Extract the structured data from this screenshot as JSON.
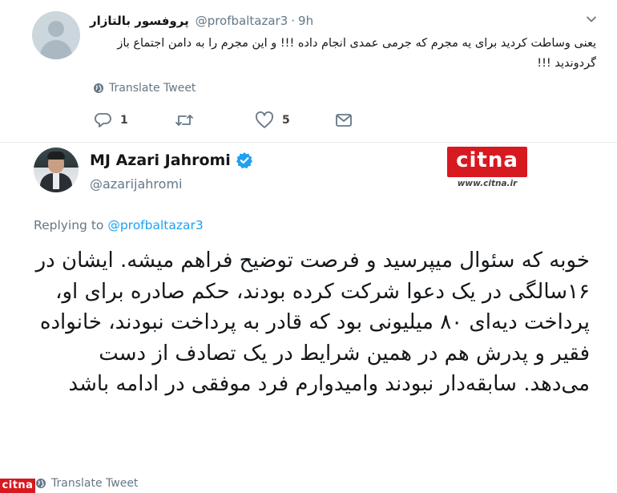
{
  "reply_tweet": {
    "author_name": "پروفسور بالتازار",
    "handle": "@profbaltazar3",
    "separator": "·",
    "time": "9h",
    "text": "یعنی وساطت کردید برای یه مجرم که جرمی عمدی انجام داده !!! و این مجرم را به دامن اجتماع باز گردوندید !!!",
    "translate_label": "Translate Tweet",
    "reply_count": "1",
    "retweet_count": "",
    "like_count": "5"
  },
  "main_tweet": {
    "author_name": "MJ Azari Jahromi",
    "handle": "@azarijahromi",
    "replying_prefix": "Replying to",
    "replying_to": "@profbaltazar3",
    "text": "خوبه که سئوال میپرسید و فرصت توضیح فراهم میشه. ایشان در ۱۶سالگی در یک دعوا شرکت کرده بودند، حکم صادره برای او، پرداخت دیه‌ای ۸۰ میلیونی بود که قادر به پرداخت نبودند، خانواده فقیر و پدرش هم در همین شرایط در یک تصادف از دست می‌دهد. سابقه‌دار نبودند وامیدوارم فرد موفقی در ادامه باشد",
    "translate_label": "Translate Tweet"
  },
  "watermark": {
    "brand": "citna",
    "url": "www.citna.ir"
  },
  "colors": {
    "brand_red": "#d71920",
    "link_blue": "#1da1f2",
    "muted_gray": "#657786"
  },
  "icons": [
    "chevron-down-icon",
    "globe-icon",
    "reply-icon",
    "retweet-icon",
    "like-icon",
    "message-icon",
    "verified-icon"
  ]
}
